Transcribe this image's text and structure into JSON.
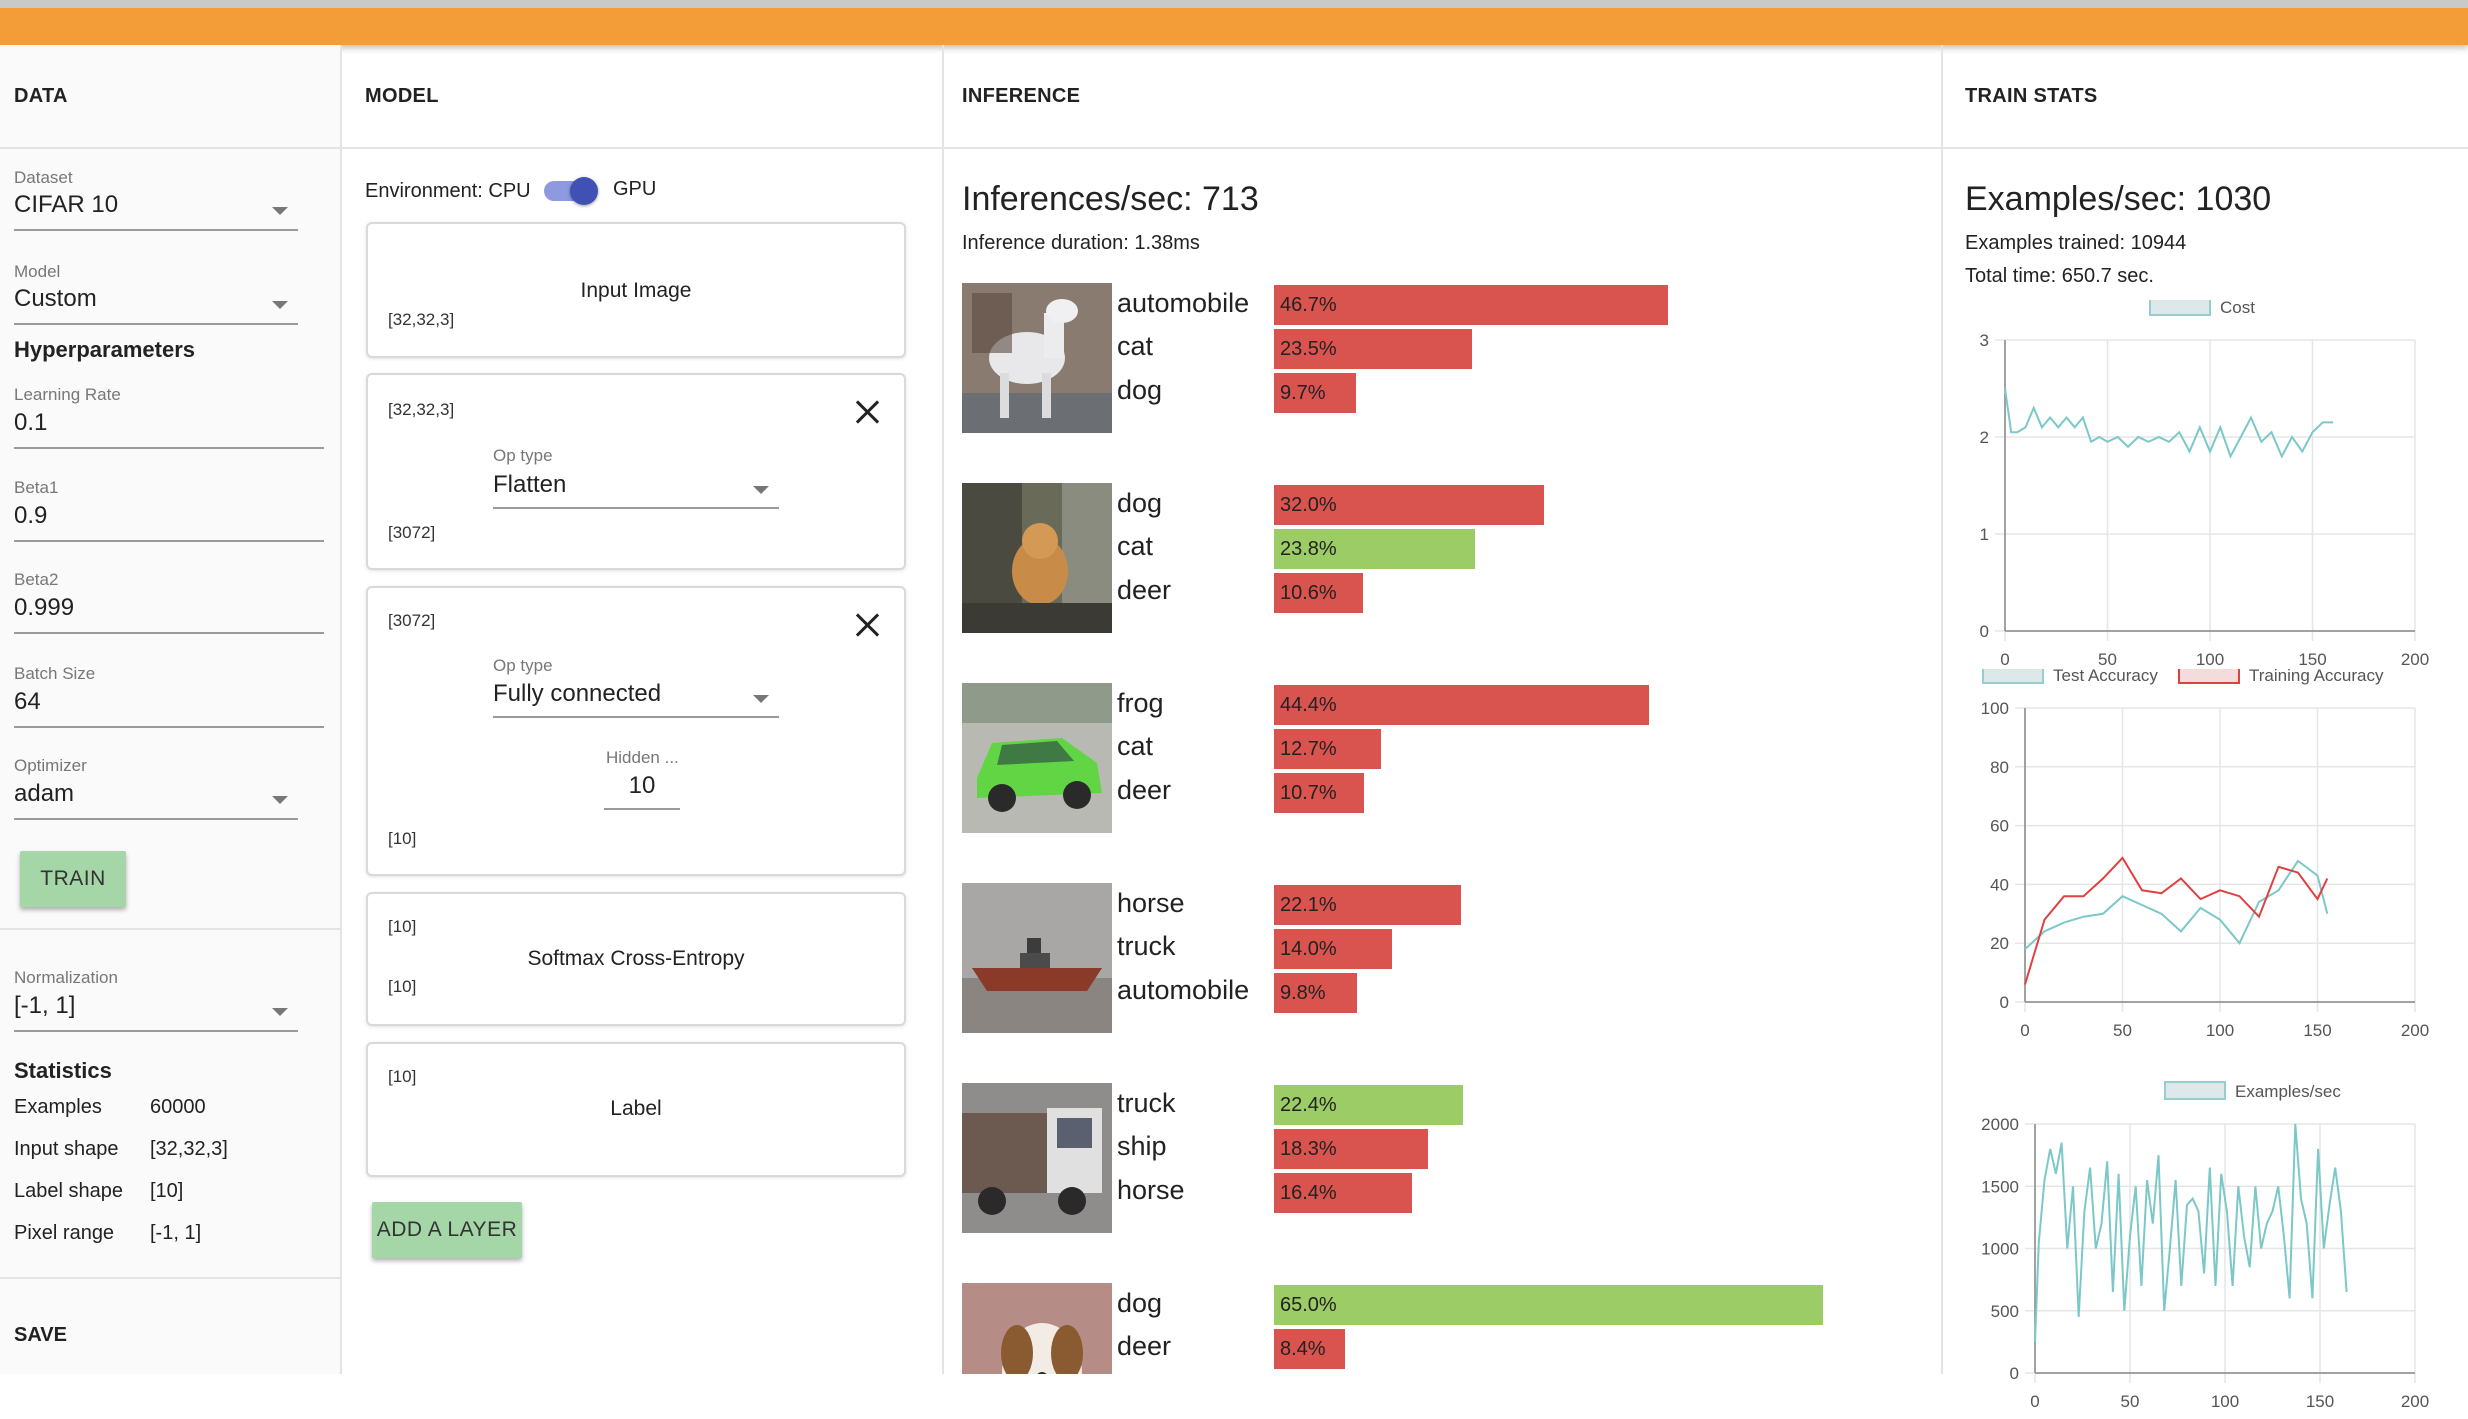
{
  "columns": {
    "data": "DATA",
    "model": "MODEL",
    "inference": "INFERENCE",
    "train_stats": "TRAIN STATS"
  },
  "data_panel": {
    "dataset": {
      "label": "Dataset",
      "value": "CIFAR 10"
    },
    "model": {
      "label": "Model",
      "value": "Custom"
    },
    "hyperparameters_title": "Hyperparameters",
    "learning_rate": {
      "label": "Learning Rate",
      "value": "0.1"
    },
    "beta1": {
      "label": "Beta1",
      "value": "0.9"
    },
    "beta2": {
      "label": "Beta2",
      "value": "0.999"
    },
    "batch_size": {
      "label": "Batch Size",
      "value": "64"
    },
    "optimizer": {
      "label": "Optimizer",
      "value": "adam"
    },
    "train_button": "TRAIN",
    "normalization": {
      "label": "Normalization",
      "value": "[-1, 1]"
    },
    "statistics_title": "Statistics",
    "statistics": [
      {
        "key": "Examples",
        "value": "60000"
      },
      {
        "key": "Input shape",
        "value": "[32,32,3]"
      },
      {
        "key": "Label shape",
        "value": "[10]"
      },
      {
        "key": "Pixel range",
        "value": "[-1, 1]"
      }
    ],
    "save_title": "SAVE"
  },
  "model_panel": {
    "environment_label": "Environment: CPU",
    "environment_gpu": "GPU",
    "layers": [
      {
        "title": "Input Image",
        "output_shape": "[32,32,3]"
      },
      {
        "input_shape": "[32,32,3]",
        "op_type_label": "Op type",
        "op_type": "Flatten",
        "output_shape": "[3072]"
      },
      {
        "input_shape": "[3072]",
        "op_type_label": "Op type",
        "op_type": "Fully connected",
        "hidden_label": "Hidden ...",
        "hidden_value": "10",
        "output_shape": "[10]"
      },
      {
        "input_shape": "[10]",
        "title": "Softmax Cross-Entropy",
        "output_shape": "[10]"
      },
      {
        "input_shape": "[10]",
        "title": "Label"
      }
    ],
    "add_layer_button": "ADD A LAYER"
  },
  "inference_panel": {
    "inferences_per_sec": "Inferences/sec: 713",
    "inference_duration": "Inference duration: 1.38ms",
    "colors": {
      "wrong": "#d9534f",
      "correct": "#9ccc65"
    },
    "results": [
      {
        "image": "white-horse-thumbnail",
        "predictions": [
          {
            "label": "automobile",
            "percent": "46.7%",
            "value": 46.7,
            "correct": false
          },
          {
            "label": "cat",
            "percent": "23.5%",
            "value": 23.5,
            "correct": false
          },
          {
            "label": "dog",
            "percent": "9.7%",
            "value": 9.7,
            "correct": false
          }
        ]
      },
      {
        "image": "orange-cat-thumbnail",
        "predictions": [
          {
            "label": "dog",
            "percent": "32.0%",
            "value": 32.0,
            "correct": false
          },
          {
            "label": "cat",
            "percent": "23.8%",
            "value": 23.8,
            "correct": true
          },
          {
            "label": "deer",
            "percent": "10.6%",
            "value": 10.6,
            "correct": false
          }
        ]
      },
      {
        "image": "green-car-thumbnail",
        "predictions": [
          {
            "label": "frog",
            "percent": "44.4%",
            "value": 44.4,
            "correct": false
          },
          {
            "label": "cat",
            "percent": "12.7%",
            "value": 12.7,
            "correct": false
          },
          {
            "label": "deer",
            "percent": "10.7%",
            "value": 10.7,
            "correct": false
          }
        ]
      },
      {
        "image": "ship-thumbnail",
        "predictions": [
          {
            "label": "horse",
            "percent": "22.1%",
            "value": 22.1,
            "correct": false
          },
          {
            "label": "truck",
            "percent": "14.0%",
            "value": 14.0,
            "correct": false
          },
          {
            "label": "automobile",
            "percent": "9.8%",
            "value": 9.8,
            "correct": false
          }
        ]
      },
      {
        "image": "truck-thumbnail",
        "predictions": [
          {
            "label": "truck",
            "percent": "22.4%",
            "value": 22.4,
            "correct": true
          },
          {
            "label": "ship",
            "percent": "18.3%",
            "value": 18.3,
            "correct": false
          },
          {
            "label": "horse",
            "percent": "16.4%",
            "value": 16.4,
            "correct": false
          }
        ]
      },
      {
        "image": "dog-thumbnail",
        "predictions": [
          {
            "label": "dog",
            "percent": "65.0%",
            "value": 65.0,
            "correct": true
          },
          {
            "label": "deer",
            "percent": "8.4%",
            "value": 8.4,
            "correct": false
          }
        ]
      }
    ]
  },
  "stats_panel": {
    "examples_per_sec": "Examples/sec: 1030",
    "examples_trained": "Examples trained: 10944",
    "total_time": "Total time: 650.7 sec."
  },
  "chart_data": [
    {
      "type": "line",
      "series": [
        {
          "name": "Cost",
          "color": "#7cc8c8",
          "x": [
            0,
            3,
            6,
            10,
            14,
            18,
            22,
            26,
            30,
            34,
            38,
            42,
            46,
            50,
            55,
            60,
            65,
            70,
            75,
            80,
            85,
            90,
            95,
            100,
            105,
            110,
            115,
            120,
            125,
            130,
            135,
            140,
            145,
            150,
            155,
            160
          ],
          "y": [
            2.5,
            2.05,
            2.05,
            2.1,
            2.3,
            2.1,
            2.2,
            2.1,
            2.2,
            2.1,
            2.2,
            1.95,
            2.0,
            1.95,
            2.0,
            1.9,
            2.0,
            1.95,
            2.0,
            1.95,
            2.05,
            1.85,
            2.1,
            1.85,
            2.1,
            1.8,
            2.0,
            2.2,
            1.95,
            2.05,
            1.8,
            2.0,
            1.85,
            2.05,
            2.15,
            2.15
          ]
        }
      ],
      "xlim": [
        0,
        200
      ],
      "ylim": [
        0,
        3
      ],
      "xticks": [
        0,
        50,
        100,
        150,
        200
      ],
      "yticks": [
        0,
        1,
        2,
        3
      ],
      "legend": "top",
      "grid": true
    },
    {
      "type": "line",
      "series": [
        {
          "name": "Test Accuracy",
          "color": "#7cc8c8",
          "x": [
            0,
            10,
            20,
            30,
            40,
            50,
            60,
            70,
            80,
            90,
            100,
            110,
            120,
            130,
            140,
            150,
            155
          ],
          "y": [
            18,
            24,
            27,
            29,
            30,
            36,
            33,
            30,
            24,
            32,
            28,
            20,
            34,
            38,
            48,
            43,
            30
          ]
        },
        {
          "name": "Training Accuracy",
          "color": "#e04040",
          "x": [
            0,
            10,
            20,
            30,
            40,
            50,
            60,
            70,
            80,
            90,
            100,
            110,
            120,
            130,
            140,
            150,
            155
          ],
          "y": [
            6,
            28,
            36,
            36,
            42,
            49,
            38,
            37,
            42,
            35,
            38,
            36,
            29,
            46,
            44,
            35,
            42
          ]
        }
      ],
      "xlim": [
        0,
        200
      ],
      "ylim": [
        0,
        100
      ],
      "xticks": [
        0,
        50,
        100,
        150,
        200
      ],
      "yticks": [
        0,
        20,
        40,
        60,
        80,
        100
      ],
      "legend": "top",
      "grid": true
    },
    {
      "type": "line",
      "series": [
        {
          "name": "Examples/sec",
          "color": "#7cc8c8",
          "x": [
            0,
            2,
            5,
            8,
            11,
            14,
            17,
            20,
            23,
            26,
            29,
            32,
            35,
            38,
            41,
            44,
            47,
            50,
            53,
            56,
            59,
            62,
            65,
            68,
            71,
            74,
            77,
            80,
            83,
            86,
            89,
            92,
            95,
            98,
            101,
            104,
            107,
            110,
            113,
            116,
            119,
            122,
            125,
            128,
            131,
            134,
            137,
            140,
            143,
            146,
            149,
            152,
            155,
            158,
            161,
            164
          ],
          "y": [
            250,
            1050,
            1550,
            1800,
            1600,
            1850,
            1000,
            1500,
            450,
            1300,
            1650,
            1000,
            1200,
            1700,
            650,
            1600,
            500,
            1100,
            1500,
            700,
            1550,
            1200,
            1750,
            500,
            1000,
            1550,
            700,
            1350,
            1400,
            1300,
            800,
            1650,
            700,
            1600,
            1300,
            700,
            1500,
            1100,
            850,
            1500,
            1000,
            1200,
            1300,
            1500,
            1100,
            600,
            2000,
            1400,
            1200,
            600,
            1800,
            1000,
            1350,
            1650,
            1300,
            650
          ]
        }
      ],
      "xlim": [
        0,
        200
      ],
      "ylim": [
        0,
        2000
      ],
      "xticks": [
        0,
        50,
        100,
        150,
        200
      ],
      "yticks": [
        0,
        500,
        1000,
        1500,
        2000
      ],
      "legend": "top",
      "grid": true
    }
  ]
}
